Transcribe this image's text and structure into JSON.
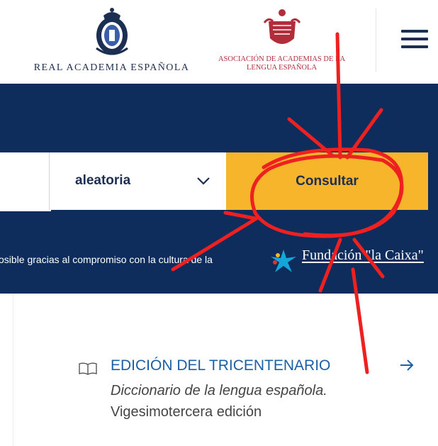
{
  "header": {
    "rae_name": "REAL ACADEMIA ESPAÑOLA",
    "asale_line1": "ASOCIACIÓN DE ACADEMIAS DE LA",
    "asale_line2": "LENGUA ESPAÑOLA"
  },
  "search": {
    "input_value": "",
    "select_value": "aleatoria",
    "submit_label": "Consultar"
  },
  "sponsor": {
    "text": "Este servicio es posible gracias al compromiso con la cultura de la",
    "visible_text": "osible gracias al compromiso con la cultura de la",
    "partner_link": "Fundación \"la Caixa\""
  },
  "edition": {
    "title": "EDICIÓN DEL TRICENTENARIO",
    "subtitle": "Diccionario de la lengua española.",
    "subtitle2": "Vigesimotercera edición"
  },
  "icons": {
    "menu": "hamburger-icon",
    "chevron": "chevron-down-icon",
    "book": "book-open-icon",
    "arrow": "arrow-right-icon",
    "partner_logo": "caixa-star-logo"
  },
  "colors": {
    "navy": "#0e2d5c",
    "gold": "#f6b52b",
    "link_blue": "#1b5fa5",
    "annotation_red": "#ee2020"
  }
}
